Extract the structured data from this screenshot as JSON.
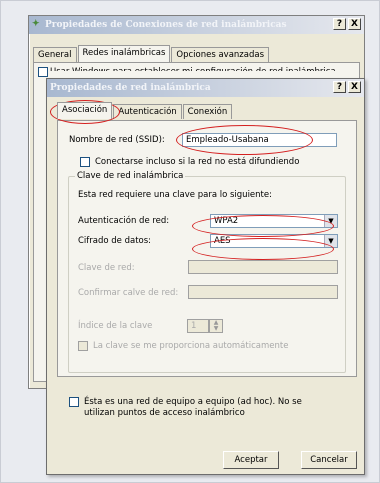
{
  "outer_window": {
    "title": "Propiedades de Conexiones de red inalámbricas",
    "help_btn": "?",
    "close_btn": "X",
    "tabs": [
      "General",
      "Redes inalámbricas",
      "Opciones avanzadas"
    ],
    "obscured_text": "Usar Windows para establecer mi configuración de red inalámbrica"
  },
  "dialog": {
    "title": "Propiedades de red inalámbrica",
    "help_btn": "?",
    "close_btn": "X",
    "tabs": [
      "Asociación",
      "Autenticación",
      "Conexión"
    ],
    "ssid_label": "Nombre de red (SSID):",
    "ssid_value": "Empleado-Usabana",
    "connect_hidden_label": "Conectarse incluso si la red no está difundiendo",
    "key_group_legend": "Clave de red inalámbrica",
    "key_group_desc": "Esta red requiere una clave para lo siguiente:",
    "auth_label": "Autenticación de red:",
    "auth_value": "WPA2",
    "cipher_label": "Cifrado de datos:",
    "cipher_value": "AES",
    "net_key_label": "Clave de red:",
    "confirm_key_label": "Confirmar calve de red:",
    "key_index_label": "Índice de la clave",
    "key_index_value": "1",
    "auto_key_label": "La clave se me proporciona automáticamente",
    "adhoc_label": "Ésta es una red de equipo a equipo (ad hoc). No se utilizan puntos de acceso inalámbrico",
    "ok_button": "Aceptar",
    "cancel_button": "Cancelar"
  },
  "colors": {
    "highlight_ring": "#d42020"
  }
}
